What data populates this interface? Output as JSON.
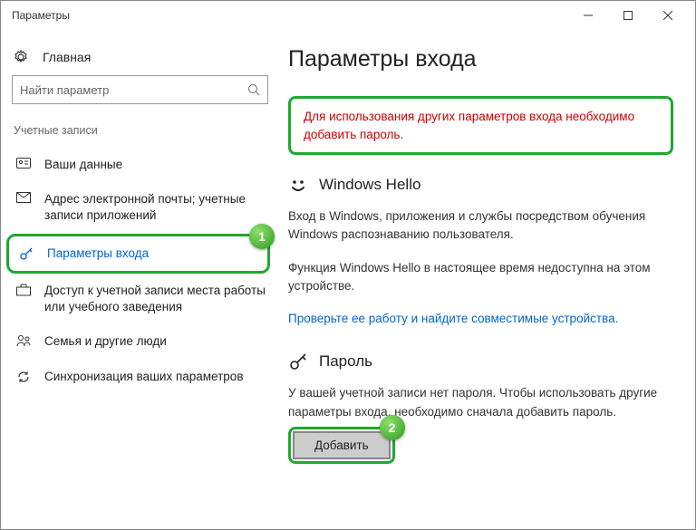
{
  "window": {
    "title": "Параметры"
  },
  "sidebar": {
    "home": "Главная",
    "search_placeholder": "Найти параметр",
    "section": "Учетные записи",
    "items": [
      {
        "label": "Ваши данные"
      },
      {
        "label": "Адрес электронной почты; учетные записи приложений"
      },
      {
        "label": "Параметры входа"
      },
      {
        "label": "Доступ к учетной записи места работы или учебного заведения"
      },
      {
        "label": "Семья и другие люди"
      },
      {
        "label": "Синхронизация ваших параметров"
      }
    ]
  },
  "main": {
    "title": "Параметры входа",
    "warning": "Для использования других параметров входа необходимо добавить пароль.",
    "hello": {
      "heading": "Windows Hello",
      "desc": "Вход в Windows, приложения и службы посредством обучения Windows распознаванию пользователя.",
      "unavailable": "Функция Windows Hello в настоящее время недоступна на этом устройстве.",
      "link": "Проверьте ее работу и найдите совместимые устройства."
    },
    "password": {
      "heading": "Пароль",
      "desc": "У вашей учетной записи нет пароля. Чтобы использовать другие параметры входа, необходимо сначала добавить пароль.",
      "button": "Добавить"
    }
  },
  "badges": {
    "one": "1",
    "two": "2"
  }
}
